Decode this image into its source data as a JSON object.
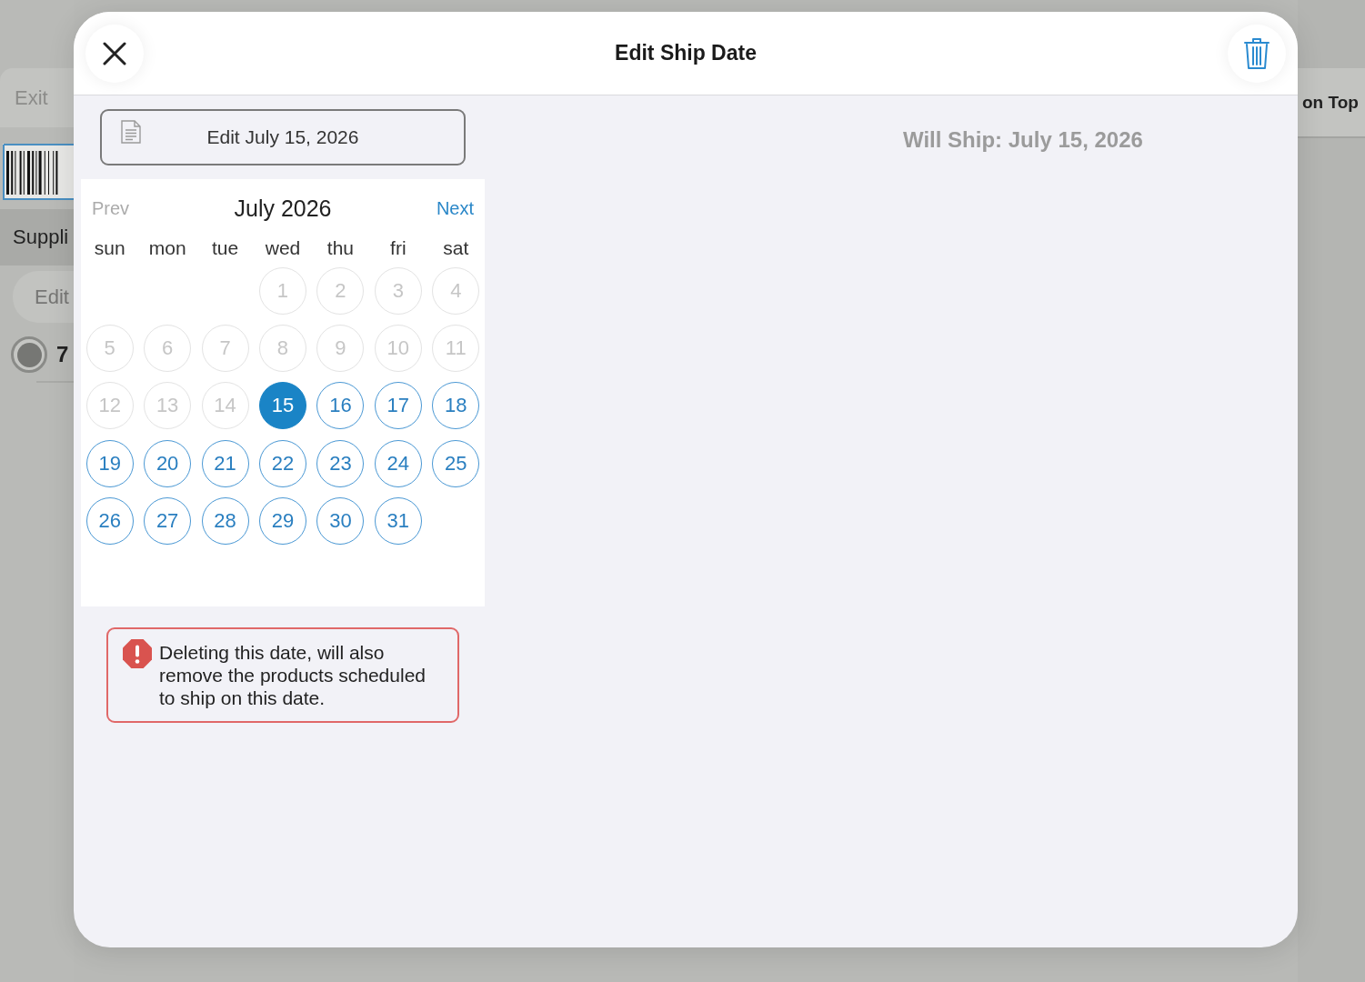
{
  "background": {
    "toolbar": {
      "exit_button": "Exit",
      "right_button": "on Top"
    },
    "section_header": "Suppli",
    "edit_button": "Edit",
    "radio": {
      "label": "7",
      "selected": true
    }
  },
  "dialog": {
    "title": "Edit Ship Date",
    "edit_button": "Edit July 15, 2026",
    "will_ship": "Will Ship: July 15, 2026",
    "calendar": {
      "prev": {
        "label": "Prev",
        "disabled": true
      },
      "month": "July 2026",
      "next": {
        "label": "Next",
        "disabled": false
      },
      "weekdays": [
        "sun",
        "mon",
        "tue",
        "wed",
        "thu",
        "fri",
        "sat"
      ],
      "weeks": [
        {
          "days": [
            {
              "label": "1",
              "disabled": true,
              "selected": false
            },
            {
              "label": "2",
              "disabled": true,
              "selected": false
            },
            {
              "label": "3",
              "disabled": true,
              "selected": false
            },
            {
              "label": "4",
              "disabled": true,
              "selected": false
            }
          ]
        },
        {
          "days": [
            {
              "label": "5",
              "disabled": true,
              "selected": false
            },
            {
              "label": "6",
              "disabled": true,
              "selected": false
            },
            {
              "label": "7",
              "disabled": true,
              "selected": false
            },
            {
              "label": "8",
              "disabled": true,
              "selected": false
            },
            {
              "label": "9",
              "disabled": true,
              "selected": false
            },
            {
              "label": "10",
              "disabled": true,
              "selected": false
            },
            {
              "label": "11",
              "disabled": true,
              "selected": false
            }
          ]
        },
        {
          "days": [
            {
              "label": "12",
              "disabled": true,
              "selected": false
            },
            {
              "label": "13",
              "disabled": true,
              "selected": false
            },
            {
              "label": "14",
              "disabled": true,
              "selected": false
            },
            {
              "label": "15",
              "disabled": false,
              "selected": true
            },
            {
              "label": "16",
              "disabled": false,
              "selected": false
            },
            {
              "label": "17",
              "disabled": false,
              "selected": false
            },
            {
              "label": "18",
              "disabled": false,
              "selected": false
            }
          ]
        },
        {
          "days": [
            {
              "label": "19",
              "disabled": false,
              "selected": false
            },
            {
              "label": "20",
              "disabled": false,
              "selected": false
            },
            {
              "label": "21",
              "disabled": false,
              "selected": false
            },
            {
              "label": "22",
              "disabled": false,
              "selected": false
            },
            {
              "label": "23",
              "disabled": false,
              "selected": false
            },
            {
              "label": "24",
              "disabled": false,
              "selected": false
            },
            {
              "label": "25",
              "disabled": false,
              "selected": false
            }
          ]
        },
        {
          "days": [
            {
              "label": "26",
              "disabled": false,
              "selected": false
            },
            {
              "label": "27",
              "disabled": false,
              "selected": false
            },
            {
              "label": "28",
              "disabled": false,
              "selected": false
            },
            {
              "label": "29",
              "disabled": false,
              "selected": false
            },
            {
              "label": "30",
              "disabled": false,
              "selected": false
            },
            {
              "label": "31",
              "disabled": false,
              "selected": false
            }
          ]
        }
      ]
    },
    "warning": "Deleting this date, will also remove the products scheduled to ship on this date."
  }
}
